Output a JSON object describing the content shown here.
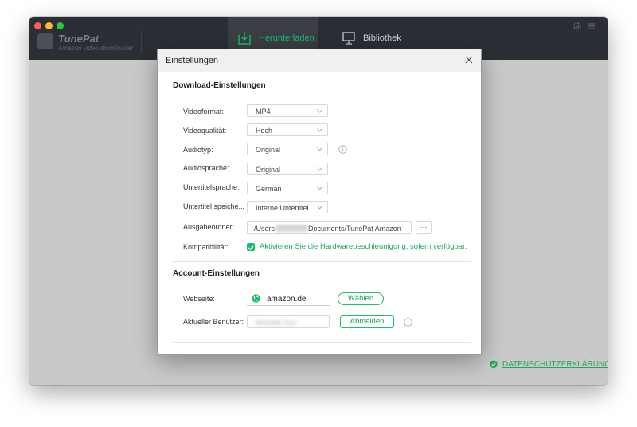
{
  "app": {
    "name": "TunePat",
    "subtitle": "Amazon video downloader"
  },
  "tabs": [
    {
      "label": "Herunterladen",
      "icon": "download-icon",
      "active": true
    },
    {
      "label": "Bibliothek",
      "icon": "monitor-icon",
      "active": false
    }
  ],
  "privacy_link": "DATENSCHUTZERKLÄRUNG",
  "dialog": {
    "title": "Einstellungen",
    "download_section": {
      "title": "Download-Einstellungen",
      "rows": [
        {
          "label": "Videoformat:",
          "value": "MP4"
        },
        {
          "label": "Videoqualität:",
          "value": "Hoch"
        },
        {
          "label": "Audiotyp:",
          "value": "Original"
        },
        {
          "label": "Audiosprache:",
          "value": "Original"
        },
        {
          "label": "Untertitelsprache:",
          "value": "German"
        },
        {
          "label": "Untertitel speiche...",
          "value": "Interne Untertitel"
        }
      ],
      "output_label": "Ausgabeordner:",
      "output_prefix": "/Users",
      "output_suffix": "Documents/TunePat Amazon",
      "browse_label": "···",
      "compat_label": "Kompatibilität:",
      "compat_text": "Aktivieren Sie die Hardwarebeschleunigung, sofern verfügbar.",
      "compat_checked": true
    },
    "account_section": {
      "title": "Account-Einstellungen",
      "website_label": "Webseite:",
      "website_value": "amazon.de",
      "choose_button": "Wählen",
      "user_label": "Aktueller Benutzer:",
      "user_value": "Michelle Sun",
      "logout_button": "Abmelden"
    }
  },
  "colors": {
    "accent": "#1fbd6b",
    "titlebar": "#2b2e34",
    "window_bg": "#c9c9c9"
  }
}
